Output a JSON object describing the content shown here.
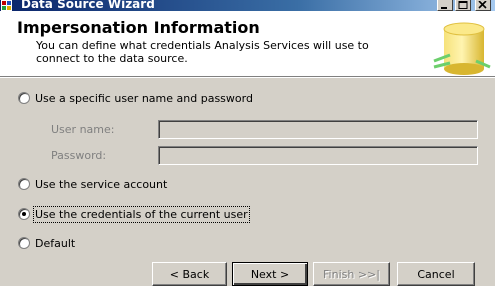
{
  "window": {
    "title": "Data Source Wizard"
  },
  "header": {
    "title": "Impersonation Information",
    "subtitle": "You can define what credentials Analysis Services will use to connect to the data source."
  },
  "options": [
    {
      "label": "Use a specific user name and password",
      "checked": false
    },
    {
      "label": "Use the service account",
      "checked": false
    },
    {
      "label": "Use the credentials of the current user",
      "checked": true
    },
    {
      "label": "Default",
      "checked": false
    }
  ],
  "fields": {
    "username_label": "User name:",
    "username_value": "",
    "password_label": "Password:",
    "password_value": ""
  },
  "buttons": {
    "back": "< Back",
    "next": "Next >",
    "finish": "Finish >>|",
    "cancel": "Cancel"
  }
}
